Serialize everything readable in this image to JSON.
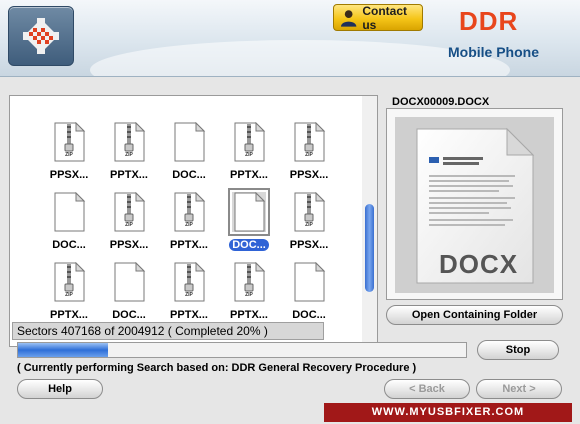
{
  "header": {
    "contact_label": "Contact us",
    "brand": "DDR",
    "product": "Mobile Phone"
  },
  "grid": {
    "cells": [
      {
        "name": "PPSX...",
        "type": "zip"
      },
      {
        "name": "PPTX...",
        "type": "zip"
      },
      {
        "name": "DOC...",
        "type": "doc"
      },
      {
        "name": "PPTX...",
        "type": "zip"
      },
      {
        "name": "PPSX...",
        "type": "zip"
      },
      {
        "name": "DOC...",
        "type": "doc"
      },
      {
        "name": "PPSX...",
        "type": "zip"
      },
      {
        "name": "PPTX...",
        "type": "zip"
      },
      {
        "name": "DOC...",
        "type": "doc",
        "selected": true
      },
      {
        "name": "PPSX...",
        "type": "zip"
      },
      {
        "name": "PPTX...",
        "type": "zip"
      },
      {
        "name": "DOC...",
        "type": "doc"
      },
      {
        "name": "PPTX...",
        "type": "zip"
      },
      {
        "name": "PPTX...",
        "type": "zip"
      },
      {
        "name": "DOC...",
        "type": "doc"
      }
    ],
    "zip_label": "ZIP"
  },
  "preview": {
    "title": "DOCX00009.DOCX",
    "doc_label": "DOCX",
    "page_heading": "Power Policy Configuration and Deployment in Windows"
  },
  "buttons": {
    "open_folder": "Open Containing Folder",
    "stop": "Stop",
    "help": "Help",
    "back": "< Back",
    "next": "Next >"
  },
  "status": {
    "sectors": "Sectors 407168 of 2004912    ( Completed 20% )",
    "progress_fraction": 0.2,
    "message": "( Currently performing Search based on: DDR General Recovery Procedure )"
  },
  "website": "WWW.MYUSBFIXER.COM"
}
